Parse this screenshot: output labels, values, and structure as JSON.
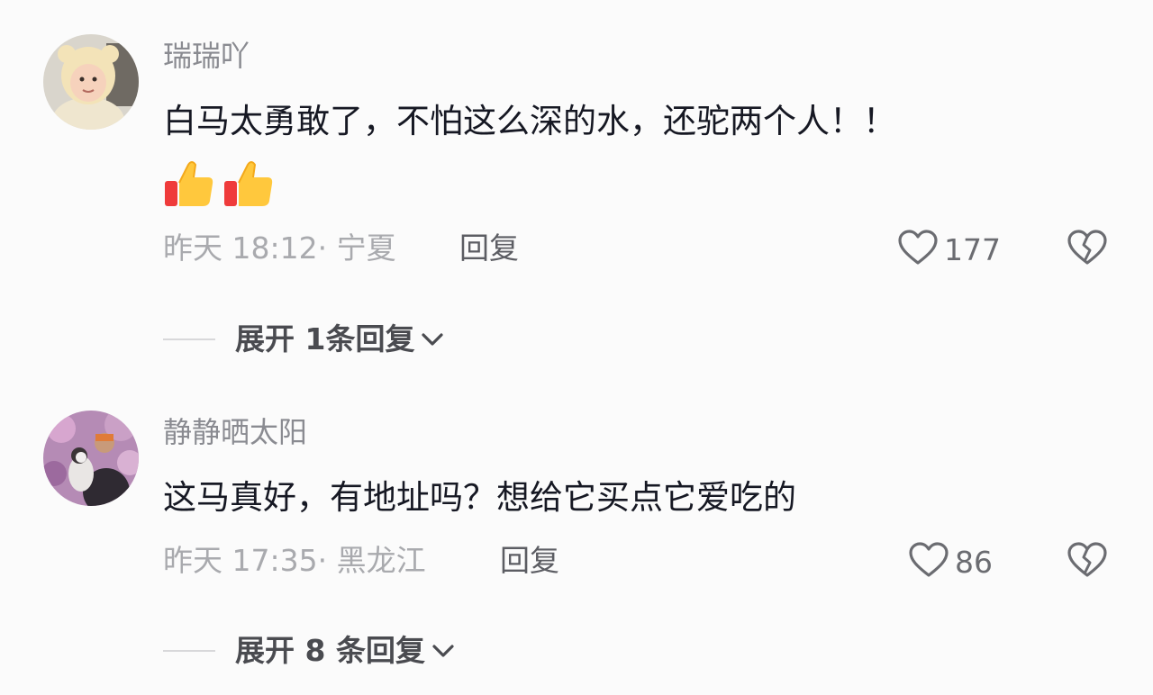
{
  "comments": [
    {
      "username": "瑞瑞吖",
      "text": "白马太勇敢了，不怕这么深的水，还驼两个人！！",
      "emojis": [
        "thumbs-up",
        "thumbs-up"
      ],
      "time": "昨天 18:12·",
      "location": "宁夏",
      "reply_label": "回复",
      "likes": "177",
      "expand_label": "展开 1条回复"
    },
    {
      "username": "静静晒太阳",
      "text": "这马真好，有地址吗？想给它买点它爱吃的",
      "emojis": [],
      "time": "昨天 17:35·",
      "location": "黑龙江",
      "reply_label": "回复",
      "likes": "86",
      "expand_label": "展开 8 条回复"
    }
  ],
  "icons": {
    "like": "heart-outline-icon",
    "dislike": "broken-heart-icon",
    "expand": "chevron-down-icon",
    "emoji": "thumbs-up-emoji-icon"
  },
  "colors": {
    "background": "#fbfbfb",
    "username": "#8a8b91",
    "meta": "#a9aaae",
    "text": "#161823"
  }
}
